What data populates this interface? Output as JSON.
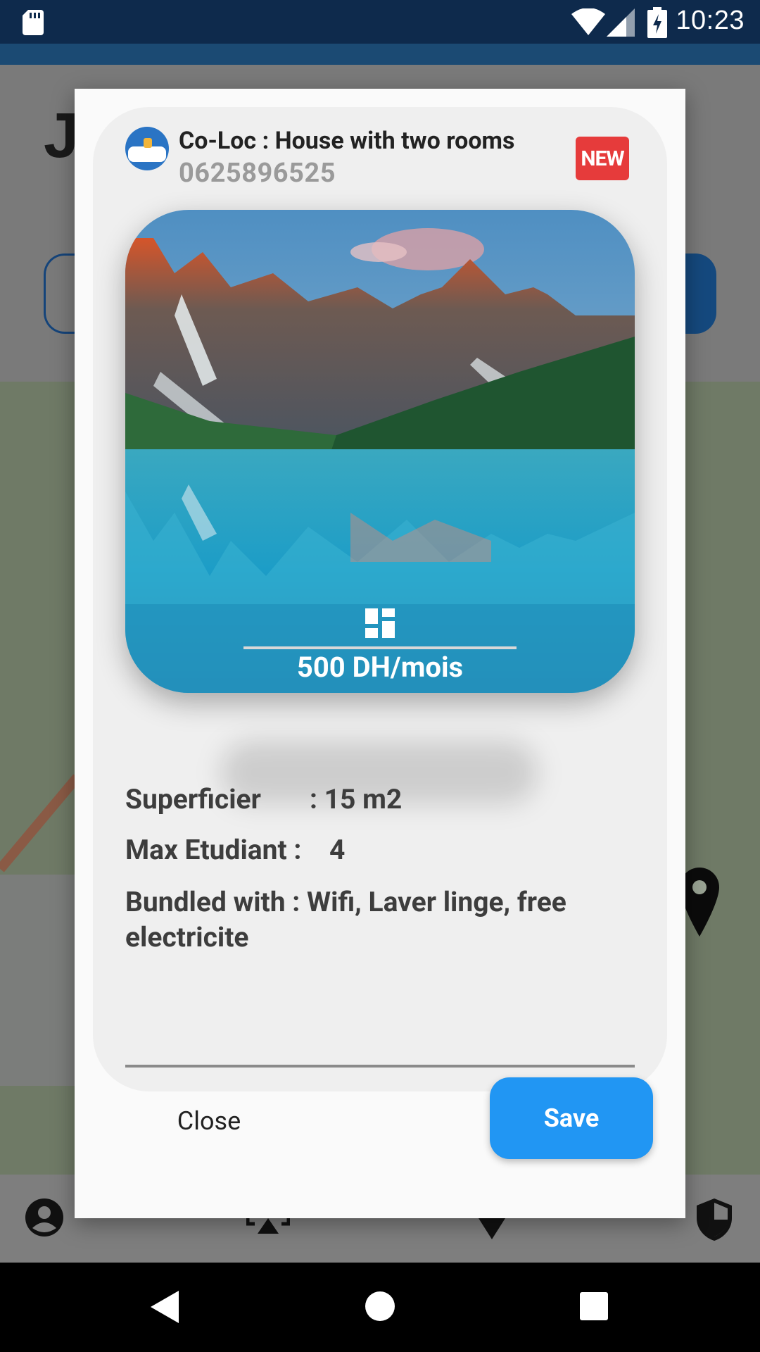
{
  "status_bar": {
    "time": "10:23",
    "icons": [
      "sd-card-icon",
      "wifi-icon",
      "signal-icon",
      "battery-charging-icon"
    ]
  },
  "background_app": {
    "title_initial": "J"
  },
  "dialog": {
    "title": "Co-Loc : House with two rooms",
    "phone": "0625896525",
    "badge": "NEW",
    "price": "500 DH/mois",
    "details": {
      "superficier_label": "Superficier",
      "superficier_value": ":  15 m2",
      "max_label": "Max Etudiant :",
      "max_value": "4",
      "bundled_text": "Bundled with :  Wifi, Laver linge, free electricite"
    },
    "close_label": "Close",
    "save_label": "Save"
  },
  "colors": {
    "status_bar": "#0e2a4c",
    "new_badge": "#e63b3b",
    "save_button": "#2196f3"
  }
}
